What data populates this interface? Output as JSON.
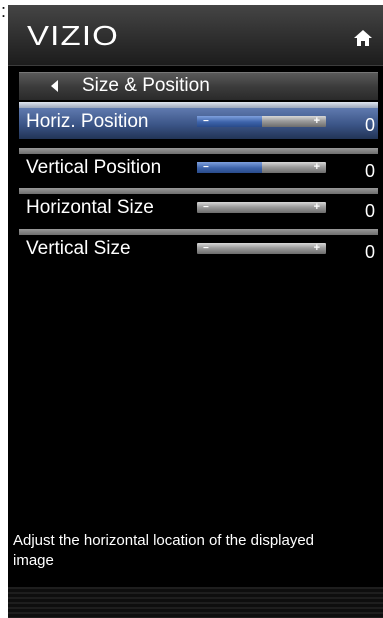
{
  "page": {
    "leading_char": ":"
  },
  "header": {
    "brand": "VIZIO",
    "home_icon": "home-icon"
  },
  "breadcrumb": {
    "back_icon": "back-arrow-icon",
    "title": "Size & Position"
  },
  "menu": {
    "selected_index": 0,
    "items": [
      {
        "label": "Horiz. Position",
        "value": "0",
        "fill_fraction": 0.5
      },
      {
        "label": "Vertical Position",
        "value": "0",
        "fill_fraction": 0.5
      },
      {
        "label": "Horizontal Size",
        "value": "0",
        "fill_fraction": 0.0
      },
      {
        "label": "Vertical Size",
        "value": "0",
        "fill_fraction": 0.0
      }
    ],
    "slider_minus": "−",
    "slider_plus": "+"
  },
  "help": {
    "text": "Adjust the horizontal location of the displayed image"
  },
  "colors": {
    "selection": "#3b5486",
    "slider_fill": "#3d63aa"
  }
}
